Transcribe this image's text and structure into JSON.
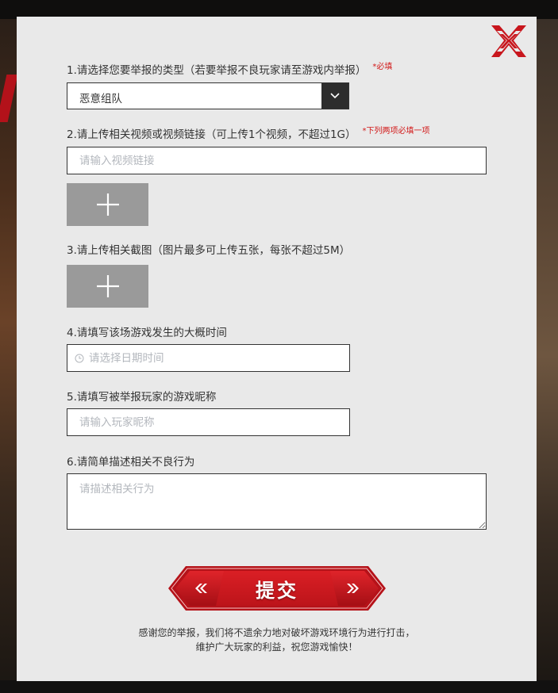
{
  "form": {
    "q1": {
      "label": "1.请选择您要举报的类型（若要举报不良玩家请至游戏内举报）",
      "required": "*必填",
      "selected": "恶意组队"
    },
    "q2": {
      "label": "2.请上传相关视频或视频链接（可上传1个视频，不超过1G）",
      "note": "*下列两项必填一项",
      "placeholder": "请输入视频链接"
    },
    "q3": {
      "label": "3.请上传相关截图（图片最多可上传五张，每张不超过5M）"
    },
    "q4": {
      "label": "4.请填写该场游戏发生的大概时间",
      "placeholder": "请选择日期时间"
    },
    "q5": {
      "label": "5.请填写被举报玩家的游戏昵称",
      "placeholder": "请输入玩家昵称"
    },
    "q6": {
      "label": "6.请简单描述相关不良行为",
      "placeholder": "请描述相关行为"
    },
    "submit_label": "提交",
    "thanks_line1": "感谢您的举报，我们将不遗余力地对破坏游戏环境行为进行打击，",
    "thanks_line2": "维护广大玩家的利益，祝您游戏愉快！"
  },
  "icons": {
    "close": "close-x-icon",
    "dropdown": "chevron-down-icon",
    "upload": "plus-icon",
    "clock": "clock-icon"
  },
  "colors": {
    "accent_red": "#c8161d",
    "required_red": "#d21a1a",
    "modal_bg": "#e9e9e9",
    "upload_bg": "#9a9a9a"
  }
}
